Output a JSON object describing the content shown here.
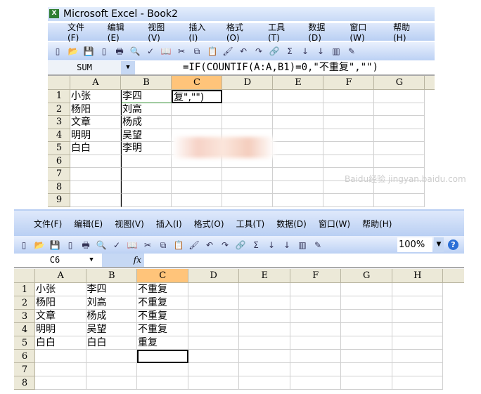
{
  "top": {
    "title": "Microsoft Excel - Book2",
    "menu": [
      "文件(F)",
      "编辑(E)",
      "视图(V)",
      "插入(I)",
      "格式(O)",
      "工具(T)",
      "数据(D)",
      "窗口(W)",
      "帮助(H)"
    ],
    "toolbar_icons": [
      "new-icon",
      "open-icon",
      "save-icon",
      "permission-icon",
      "print-icon",
      "print-preview-icon",
      "spelling-icon",
      "research-icon",
      "cut-icon",
      "copy-icon",
      "paste-icon",
      "format-painter-icon",
      "undo-icon",
      "redo-icon",
      "hyperlink-icon",
      "autosum-icon",
      "sort-asc-icon",
      "sort-desc-icon",
      "chart-icon",
      "drawing-icon"
    ],
    "name_box": "SUM",
    "formula": "=IF(COUNTIF(A:A,B1)=0,\"不重复\",\"\")",
    "columns": [
      "A",
      "B",
      "C",
      "D",
      "E",
      "F",
      "G"
    ],
    "selected_column": "C",
    "rows": [
      [
        "小张",
        "李四",
        "复\",\"\")"
      ],
      [
        "杨阳",
        "刘高",
        ""
      ],
      [
        "文章",
        "杨成",
        ""
      ],
      [
        "明明",
        "吴望",
        ""
      ],
      [
        "白白",
        "李明",
        ""
      ],
      [
        "",
        "",
        ""
      ],
      [
        "",
        "",
        ""
      ],
      [
        "",
        "",
        ""
      ],
      [
        "",
        "",
        ""
      ]
    ]
  },
  "bottom": {
    "menu": [
      "文件(F)",
      "编辑(E)",
      "视图(V)",
      "插入(I)",
      "格式(O)",
      "工具(T)",
      "数据(D)",
      "窗口(W)",
      "帮助(H)"
    ],
    "zoom": "100%",
    "name_box": "C6",
    "fx": "fx",
    "columns": [
      "A",
      "B",
      "C",
      "D",
      "E",
      "F",
      "G",
      "H"
    ],
    "selected_column": "C",
    "rows": [
      [
        "小张",
        "李四",
        "不重复"
      ],
      [
        "杨阳",
        "刘高",
        "不重复"
      ],
      [
        "文章",
        "杨成",
        "不重复"
      ],
      [
        "明明",
        "吴望",
        "不重复"
      ],
      [
        "白白",
        "白白",
        "重复"
      ],
      [
        "",
        "",
        ""
      ],
      [
        "",
        "",
        ""
      ],
      [
        "",
        "",
        ""
      ]
    ]
  },
  "watermark": "Baidu经验 jingyan.baidu.com",
  "colors": {
    "selected_header": "#ffc47a",
    "menubar": "#c8daf6",
    "header": "#ece9d8"
  }
}
